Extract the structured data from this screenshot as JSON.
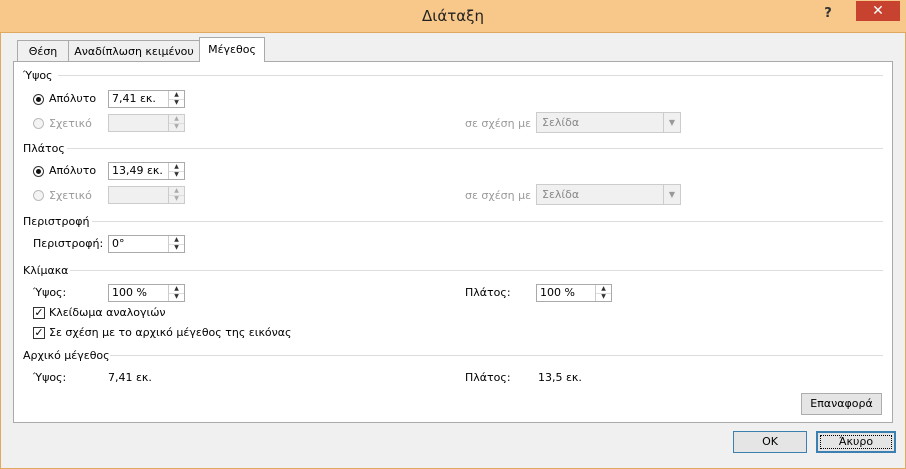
{
  "window": {
    "title": "Διάταξη",
    "help": "?",
    "close": "✕"
  },
  "tabs": [
    "Θέση",
    "Αναδίπλωση κειμένου",
    "Μέγεθος"
  ],
  "height": {
    "section": "Ύψος",
    "absolute_label": "Απόλυτο",
    "absolute_value": "7,41 εκ.",
    "relative_label": "Σχετικό",
    "relative_value": "",
    "relative_to_label": "σε σχέση με",
    "relative_to_value": "Σελίδα"
  },
  "width": {
    "section": "Πλάτος",
    "absolute_label": "Απόλυτο",
    "absolute_value": "13,49 εκ.",
    "relative_label": "Σχετικό",
    "relative_value": "",
    "relative_to_label": "σε σχέση με",
    "relative_to_value": "Σελίδα"
  },
  "rotation": {
    "section": "Περιστροφή",
    "label": "Περιστροφή:",
    "value": "0°"
  },
  "scale": {
    "section": "Κλίμακα",
    "height_label": "Ύψος:",
    "height_value": "100 %",
    "width_label": "Πλάτος:",
    "width_value": "100 %",
    "lock_aspect_label": "Κλείδωμα αναλογιών",
    "relative_original_label": "Σε σχέση με το αρχικό μέγεθος της εικόνας"
  },
  "original": {
    "section": "Αρχικό μέγεθος",
    "height_label": "Ύψος:",
    "height_value": "7,41 εκ.",
    "width_label": "Πλάτος:",
    "width_value": "13,5 εκ.",
    "reset_label": "Επαναφορά"
  },
  "buttons": {
    "ok": "OK",
    "cancel": "Άκυρο"
  },
  "icons": {
    "spin_up": "spin-up-arrow",
    "spin_down": "spin-down-arrow",
    "dropdown": "chevron-down"
  }
}
